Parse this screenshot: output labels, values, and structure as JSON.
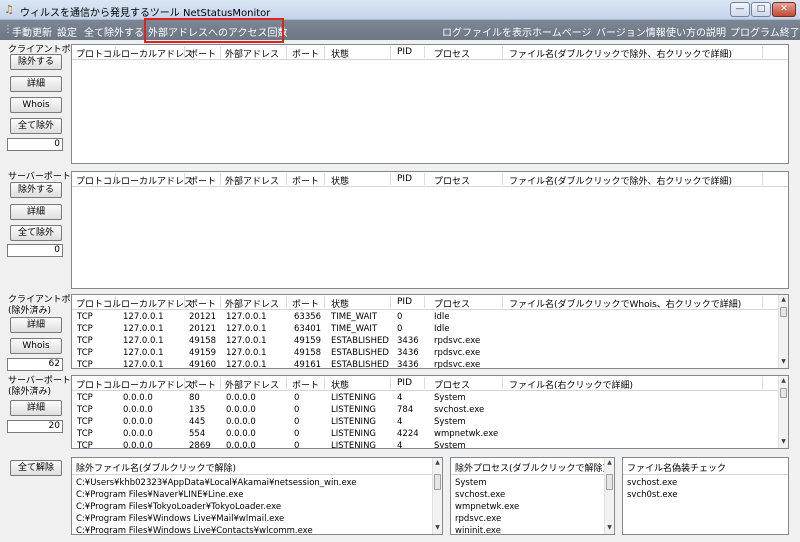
{
  "window": {
    "title": "ウィルスを通信から発見するツール NetStatusMonitor",
    "min_glyph": "—",
    "max_glyph": "□",
    "close_glyph": "✕"
  },
  "menu": {
    "items": [
      "手動更新",
      "設定",
      "全て除外する",
      "外部アドレスへのアクセス回数"
    ],
    "right_items": [
      "ログファイルを表示",
      "ホームページ",
      "バージョン情報",
      "使い方の説明",
      "プログラム終了"
    ]
  },
  "columns": {
    "protocol": "プロトコル",
    "local": "ローカルアドレス",
    "port": "ポート",
    "remote": "外部アドレス",
    "rport": "ポート",
    "state": "状態",
    "pid": "PID",
    "process": "プロセス"
  },
  "client": {
    "label": "クライアントポート",
    "exclude": "除外する",
    "detail": "詳細",
    "whois": "Whois",
    "exclude_all": "全て除外",
    "count": "0",
    "filename_header": "ファイル名(ダブルクリックで除外、右クリックで詳細)"
  },
  "server": {
    "label": "サーバーポート",
    "exclude": "除外する",
    "detail": "詳細",
    "exclude_all": "全て除外",
    "count": "0",
    "filename_header": "ファイル名(ダブルクリックで除外、右クリックで詳細)"
  },
  "client_excluded": {
    "label1": "クライアントポート",
    "label2": "(除外済み)",
    "detail": "詳細",
    "whois": "Whois",
    "count": "62",
    "filename_header": "ファイル名(ダブルクリックでWhois、右クリックで詳細)",
    "rows": [
      [
        "TCP",
        "127.0.0.1",
        "20121",
        "127.0.0.1",
        "63356",
        "TIME_WAIT",
        "0",
        "Idle"
      ],
      [
        "TCP",
        "127.0.0.1",
        "20121",
        "127.0.0.1",
        "63401",
        "TIME_WAIT",
        "0",
        "Idle"
      ],
      [
        "TCP",
        "127.0.0.1",
        "49158",
        "127.0.0.1",
        "49159",
        "ESTABLISHED",
        "3436",
        "rpdsvc.exe"
      ],
      [
        "TCP",
        "127.0.0.1",
        "49159",
        "127.0.0.1",
        "49158",
        "ESTABLISHED",
        "3436",
        "rpdsvc.exe"
      ],
      [
        "TCP",
        "127.0.0.1",
        "49160",
        "127.0.0.1",
        "49161",
        "ESTABLISHED",
        "3436",
        "rpdsvc.exe"
      ]
    ]
  },
  "server_excluded": {
    "label1": "サーバーポート",
    "label2": "(除外済み)",
    "detail": "詳細",
    "count": "20",
    "filename_header": "ファイル名(右クリックで詳細)",
    "rows": [
      [
        "TCP",
        "0.0.0.0",
        "80",
        "0.0.0.0",
        "0",
        "LISTENING",
        "4",
        "System"
      ],
      [
        "TCP",
        "0.0.0.0",
        "135",
        "0.0.0.0",
        "0",
        "LISTENING",
        "784",
        "svchost.exe"
      ],
      [
        "TCP",
        "0.0.0.0",
        "445",
        "0.0.0.0",
        "0",
        "LISTENING",
        "4",
        "System"
      ],
      [
        "TCP",
        "0.0.0.0",
        "554",
        "0.0.0.0",
        "0",
        "LISTENING",
        "4224",
        "wmpnetwk.exe"
      ],
      [
        "TCP",
        "0.0.0.0",
        "2869",
        "0.0.0.0",
        "0",
        "LISTENING",
        "4",
        "System"
      ]
    ]
  },
  "bottom": {
    "release_all": "全て解除",
    "excluded_files": {
      "header": "除外ファイル名(ダブルクリックで解除)",
      "items": [
        "C:¥Users¥khb02323¥AppData¥Local¥Akamai¥netsession_win.exe",
        "C:¥Program Files¥Naver¥LINE¥Line.exe",
        "C:¥Program Files¥TokyoLoader¥TokyoLoader.exe",
        "C:¥Program Files¥Windows Live¥Mail¥wlmail.exe",
        "C:¥Program Files¥Windows Live¥Contacts¥wlcomm.exe"
      ]
    },
    "excluded_processes": {
      "header": "除外プロセス(ダブルクリックで解除)",
      "items": [
        "System",
        "svchost.exe",
        "wmpnetwk.exe",
        "rpdsvc.exe",
        "wininit.exe"
      ]
    },
    "fake_check": {
      "header": "ファイル名偽装チェック",
      "items": [
        "svchost.exe",
        "svch0st.exe"
      ]
    }
  }
}
